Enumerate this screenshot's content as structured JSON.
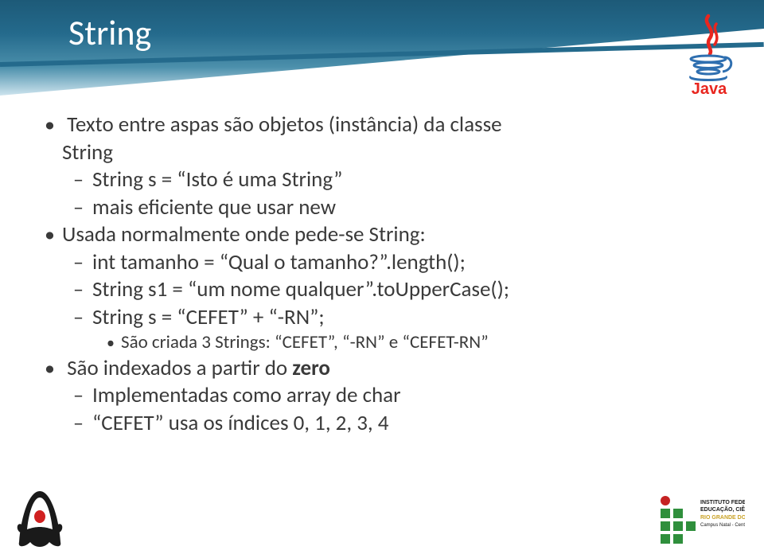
{
  "slide": {
    "title": "String",
    "bullets": {
      "b1a_l1": "Texto entre aspas são objetos (instância) da classe ",
      "b1a_l2": "String",
      "b2a": "String s = “Isto é uma String”",
      "b2b": "mais eficiente que usar new",
      "b1b": "Usada normalmente onde pede-se String:",
      "b2c": "int tamanho = “Qual o tamanho?”.length();",
      "b2d": "String s1 = “um nome qualquer”.toUpperCase();",
      "b2e": "String s = “CEFET” + “-RN”;",
      "b3a": "São criada 3 Strings: “CEFET”, “-RN” e “CEFET-RN”",
      "b1c_pre": "São indexados a partir do ",
      "b1c_bold": "zero",
      "b2f": "Implementadas como array de char",
      "b2g": "“CEFET” usa os índices 0, 1, 2, 3, 4"
    }
  },
  "logos": {
    "java": "Java",
    "duke": "duke-mascot",
    "institute": "Instituto Federal – Rio Grande do Norte"
  }
}
